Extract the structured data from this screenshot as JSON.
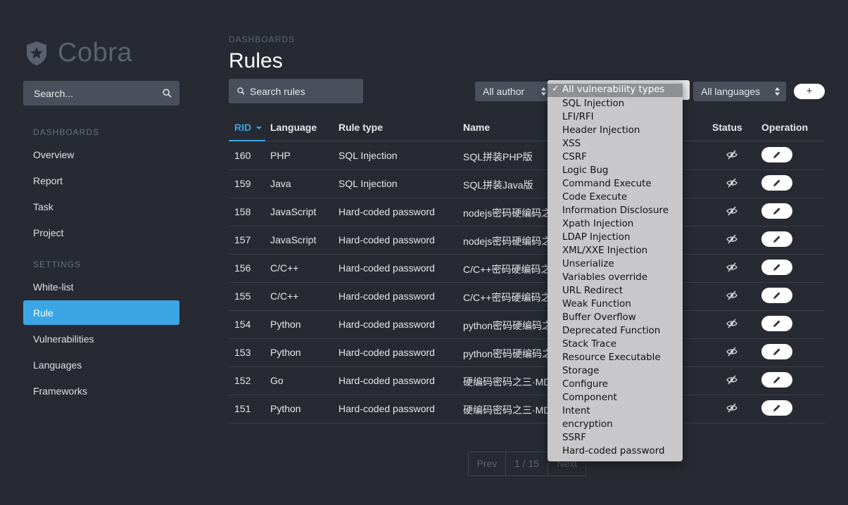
{
  "app": {
    "name": "Cobra"
  },
  "sidebar": {
    "search_placeholder": "Search...",
    "section_dashboards": "DASHBOARDS",
    "section_settings": "SETTINGS",
    "dash_items": [
      "Overview",
      "Report",
      "Task",
      "Project"
    ],
    "settings_items": [
      "White-list",
      "Rule",
      "Vulnerabilities",
      "Languages",
      "Frameworks"
    ],
    "active": "Rule"
  },
  "header": {
    "breadcrumb": "DASHBOARDS",
    "title": "Rules"
  },
  "toolbar": {
    "search_placeholder": "Search rules",
    "author_select": "All author",
    "vuln_select": "All vulnerability types",
    "language_select": "All languages",
    "add_label": "+"
  },
  "table": {
    "columns": [
      "RID",
      "Language",
      "Rule type",
      "Name",
      "Status",
      "Operation"
    ],
    "sort_column": "RID",
    "rows": [
      {
        "rid": "160",
        "language": "PHP",
        "type": "SQL Injection",
        "name": "SQL拼装PHP版"
      },
      {
        "rid": "159",
        "language": "Java",
        "type": "SQL Injection",
        "name": "SQL拼装Java版"
      },
      {
        "rid": "158",
        "language": "JavaScript",
        "type": "Hard-coded password",
        "name": "nodejs密码硬编码之"
      },
      {
        "rid": "157",
        "language": "JavaScript",
        "type": "Hard-coded password",
        "name": "nodejs密码硬编码之"
      },
      {
        "rid": "156",
        "language": "C/C++",
        "type": "Hard-coded password",
        "name": "C/C++密码硬编码之"
      },
      {
        "rid": "155",
        "language": "C/C++",
        "type": "Hard-coded password",
        "name": "C/C++密码硬编码之"
      },
      {
        "rid": "154",
        "language": "Python",
        "type": "Hard-coded password",
        "name": "python密码硬编码之"
      },
      {
        "rid": "153",
        "language": "Python",
        "type": "Hard-coded password",
        "name": "python密码硬编码之"
      },
      {
        "rid": "152",
        "language": "Go",
        "type": "Hard-coded password",
        "name": "硬编码密码之三·MD"
      },
      {
        "rid": "151",
        "language": "Python",
        "type": "Hard-coded password",
        "name": "硬编码密码之三·MD"
      }
    ]
  },
  "pagination": {
    "prev": "Prev",
    "page": "1 / 15",
    "next": "Next"
  },
  "dropdown": {
    "selected": "All vulnerability types",
    "check": "✓",
    "options": [
      "SQL Injection",
      "LFI/RFI",
      "Header Injection",
      "XSS",
      "CSRF",
      "Logic Bug",
      "Command Execute",
      "Code Execute",
      "Information Disclosure",
      "Xpath Injection",
      "LDAP Injection",
      "XML/XXE Injection",
      "Unserialize",
      "Variables override",
      "URL Redirect",
      "Weak Function",
      "Buffer Overflow",
      "Deprecated Function",
      "Stack Trace",
      "Resource Executable",
      "Storage",
      "Configure",
      "Component",
      "Intent",
      "encryption",
      "SSRF",
      "Hard-coded password"
    ]
  },
  "colors": {
    "accent": "#3ba6e3",
    "background": "#272a32",
    "input": "#4a4f5b"
  }
}
